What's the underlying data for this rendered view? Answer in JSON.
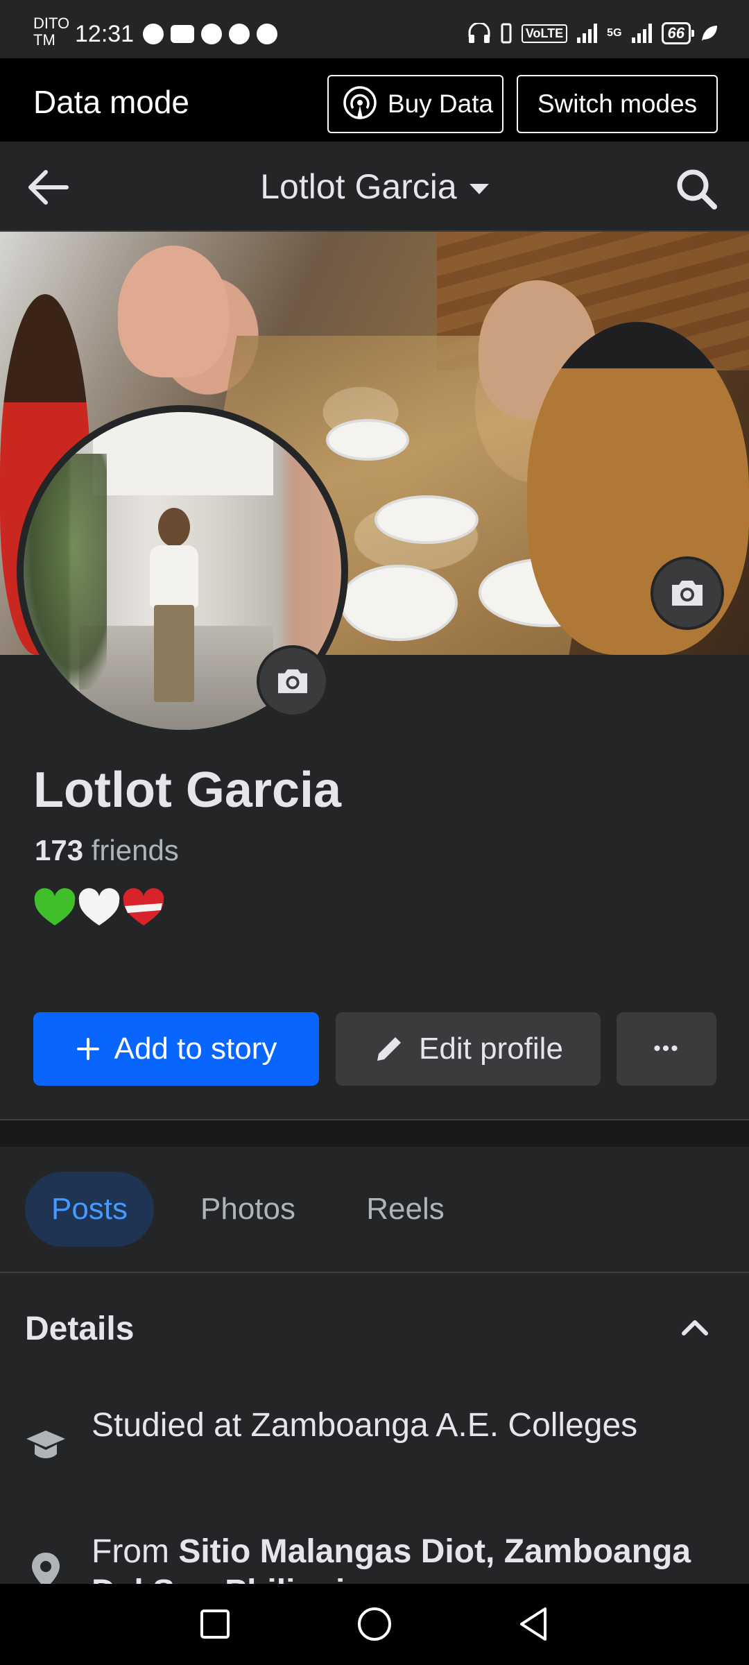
{
  "status_bar": {
    "carrier_line1": "DITO",
    "carrier_line2": "TM",
    "time": "12:31",
    "volte": "VoLTE",
    "network": "5G",
    "battery": "66"
  },
  "data_mode": {
    "title": "Data mode",
    "buy_label": "Buy Data",
    "switch_label": "Switch modes"
  },
  "nav": {
    "title": "Lotlot Garcia"
  },
  "profile": {
    "name": "Lotlot Garcia",
    "friends_count": "173",
    "friends_label": "friends",
    "hearts": [
      "green-heart",
      "white-heart",
      "red-white-heart"
    ]
  },
  "actions": {
    "add_story": "Add to story",
    "edit_profile": "Edit profile",
    "more": "•••"
  },
  "tabs": [
    {
      "label": "Posts",
      "active": true
    },
    {
      "label": "Photos",
      "active": false
    },
    {
      "label": "Reels",
      "active": false
    }
  ],
  "details": {
    "title": "Details",
    "education": "Studied at Zamboanga A.E. Colleges",
    "from_prefix": "From ",
    "from_place": "Sitio Malangas Diot, Zamboanga Del Sur, Philippines"
  },
  "colors": {
    "accent": "#0866ff",
    "background": "#242526",
    "button": "#3a3b3c"
  }
}
